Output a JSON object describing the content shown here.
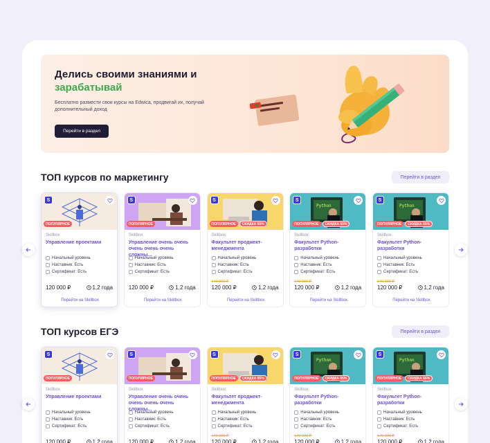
{
  "hero": {
    "title_line1": "Делись своими знаниями и",
    "title_line2": "зарабатывай",
    "subtitle": "Бесплатно размести свои курсы на Edwica, продвигай их, получай дополнительный доход",
    "button": "Перейти в раздел"
  },
  "sections": [
    {
      "title": "ТОП курсов по маркетингу",
      "button": "Перейти в раздел"
    },
    {
      "title": "ТОП курсов ЕГЭ",
      "button": "Перейти в раздел"
    }
  ],
  "cards": [
    {
      "school_badge": "S",
      "school": "Skillbox",
      "name": "Управление проектами",
      "tags": [
        "ПОПУЛЯРНОЕ"
      ],
      "level": "Начальный уровень",
      "mentor": "Наставник: Есть",
      "certificate": "Сертификат: Есть",
      "old_price": "",
      "price": "120 000 ₽",
      "duration": "1,2 года",
      "link": "Перейти на Skillbox",
      "theme": "#f6ebe1"
    },
    {
      "school_badge": "S",
      "school": "Skillbox",
      "name": "Управление очень очень очень очень очень сложны...",
      "tags": [
        "ПОПУЛЯРНОЕ"
      ],
      "level": "Начальный уровень",
      "mentor": "Наставник: Есть",
      "certificate": "Сертификат: Есть",
      "old_price": "",
      "price": "120 000 ₽",
      "duration": "1,2 года",
      "link": "Перейти на Skillbox",
      "theme": "#cda5f3"
    },
    {
      "school_badge": "S",
      "school": "Skillbox",
      "name": "Факультет проджект-менеджмента",
      "tags": [
        "ПОПУЛЯРНОЕ",
        "СКИДКА 55%"
      ],
      "level": "Начальный уровень",
      "mentor": "Наставник: Есть",
      "certificate": "Сертификат: Есть",
      "old_price": "140 000 ₽",
      "price": "120 000 ₽",
      "duration": "1,2 года",
      "link": "Перейти на Skillbox",
      "theme": "#f7d76b"
    },
    {
      "school_badge": "S",
      "school": "Skillbox",
      "name": "Факультет Python-разработки",
      "tags": [
        "ПОПУЛЯРНОЕ",
        "СКИДКА 55%"
      ],
      "level": "Начальный уровень",
      "mentor": "Наставник: Есть",
      "certificate": "Сертификат: Есть",
      "old_price": "140 000 ₽",
      "price": "120 000 ₽",
      "duration": "1,2 года",
      "link": "Перейти на Skillbox",
      "theme": "#4fb9c4"
    },
    {
      "school_badge": "S",
      "school": "Skillbox",
      "name": "Факультет Python-разработки",
      "tags": [
        "ПОПУЛЯРНОЕ",
        "СКИДКА 55%"
      ],
      "level": "Начальный уровень",
      "mentor": "Наставник: Есть",
      "certificate": "Сертификат: Есть",
      "old_price": "140 000 ₽",
      "price": "120 000 ₽",
      "duration": "1,2 года",
      "link": "Перейти на Skillbox",
      "theme": "#4fb9c4"
    }
  ],
  "colors": {
    "accent": "#6d4fd6",
    "green": "#3ea84c",
    "tag": "#ff5a5f",
    "dark": "#221d36"
  }
}
